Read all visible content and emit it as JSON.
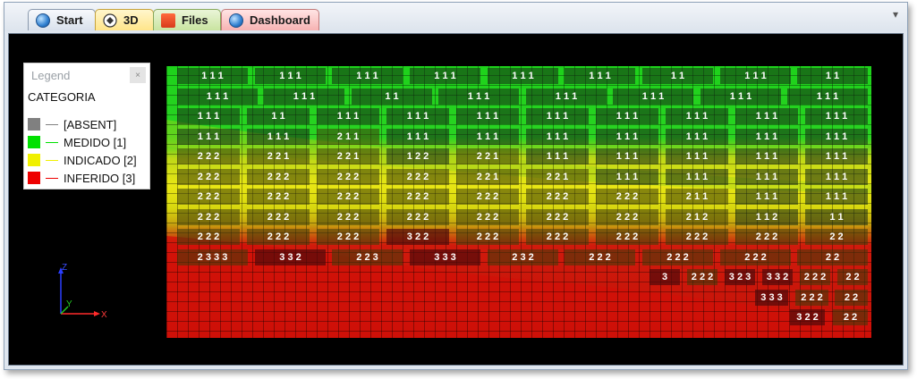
{
  "tabs": [
    {
      "label": "Start",
      "icon": "globe-icon"
    },
    {
      "label": "3D",
      "icon": "3d-view-icon"
    },
    {
      "label": "Files",
      "icon": "files-icon"
    },
    {
      "label": "Dashboard",
      "icon": "globe-icon"
    }
  ],
  "active_tab": "3D",
  "legend": {
    "title": "Legend",
    "close_glyph": "×",
    "category_title": "CATEGORIA",
    "items": [
      {
        "label": "[ABSENT]",
        "color": "#808080"
      },
      {
        "label": "MEDIDO [1]",
        "color": "#00e000"
      },
      {
        "label": "INDICADO [2]",
        "color": "#f0f000"
      },
      {
        "label": "INFERIDO [3]",
        "color": "#ee0000"
      }
    ]
  },
  "axes": {
    "z": "Z",
    "x": "X",
    "y": "Y"
  },
  "block_rows": [
    [
      "1 1 1",
      "1 1 1",
      "1 1 1",
      "1 1 1",
      "1 1 1",
      "1 1 1",
      "1 1",
      "1 1 1",
      "1 1"
    ],
    [
      "1 1 1",
      "1 1 1",
      "1 1",
      "1 1 1",
      "1 1 1",
      "1 1 1",
      "1 1 1",
      "1 1 1"
    ],
    [
      "1 1 1",
      "1 1",
      "1 1 1",
      "1 1 1",
      "1 1 1",
      "1 1 1",
      "1 1 1",
      "1 1 1",
      "1 1 1",
      "1 1 1"
    ],
    [
      "1 1 1",
      "1 1 1",
      "2 1 1",
      "1 1 1",
      "1 1 1",
      "1 1 1",
      "1 1 1",
      "1 1 1",
      "1 1 1",
      "1 1 1"
    ],
    [
      "2 2 2",
      "2 2 1",
      "2 2 1",
      "1 2 2",
      "2 2 1",
      "1 1 1",
      "1 1 1",
      "1 1 1",
      "1 1 1",
      "1 1 1"
    ],
    [
      "2 2 2",
      "2 2 2",
      "2 2 2",
      "2 2 2",
      "2 2 1",
      "2 2 1",
      "1 1 1",
      "1 1 1",
      "1 1 1",
      "1 1 1"
    ],
    [
      "2 2 2",
      "2 2 2",
      "2 2 2",
      "2 2 2",
      "2 2 2",
      "2 2 2",
      "2 2 2",
      "2 1 1",
      "1 1 1",
      "1 1 1"
    ],
    [
      "2 2 2",
      "2 2 2",
      "2 2 2",
      "2 2 2",
      "2 2 2",
      "2 2 2",
      "2 2 2",
      "2 1 2",
      "1 1 2",
      "1 1"
    ],
    [
      "2 2 2",
      "2 2 2",
      "2 2 2",
      "3 2 2",
      "2 2 2",
      "2 2 2",
      "2 2 2",
      "2 2 2",
      "2 2 2",
      "2 2"
    ],
    [
      "2 3 3 3",
      "3 3 2",
      "2 2 3",
      "3 3 3",
      "2 3 2",
      "2 2 2",
      "2 2 2",
      "2 2 2",
      "2 2"
    ],
    [
      "3",
      "2 2 2",
      "3 2 3",
      "3 3 2",
      "2 2 2",
      "2 2"
    ],
    [
      "3 3 3",
      "2 2 2",
      "2 2"
    ],
    [
      "3 2 2",
      "2 2"
    ]
  ]
}
